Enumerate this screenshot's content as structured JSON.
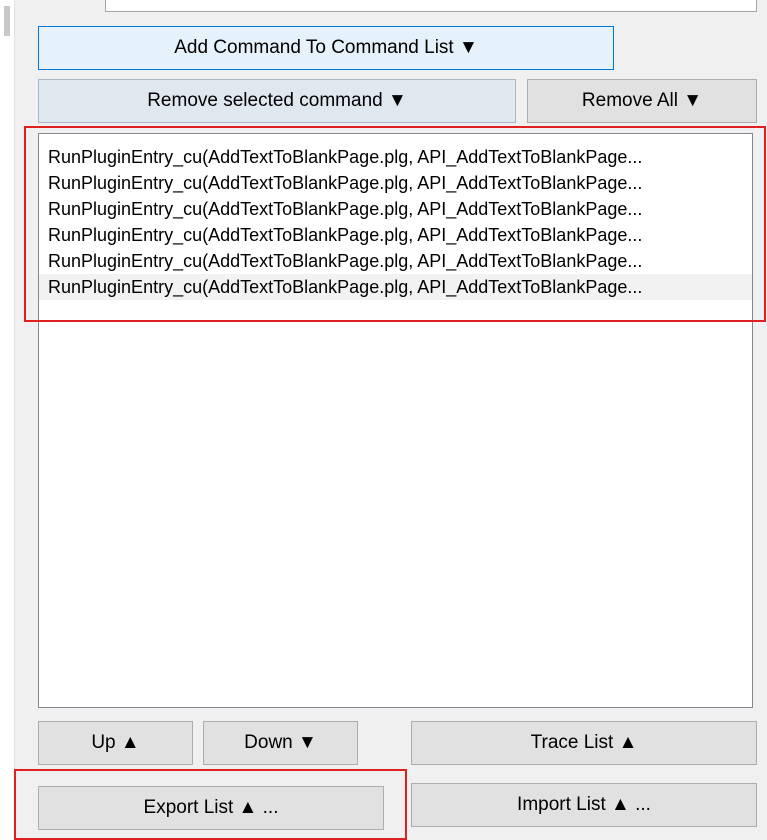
{
  "buttons": {
    "add_command": "Add Command To Command List ▼",
    "remove_selected": "Remove selected command ▼",
    "remove_all": "Remove All ▼",
    "up": "Up ▲",
    "down": "Down ▼",
    "trace_list": "Trace List ▲",
    "export_list": "Export List ▲ ...",
    "import_list": "Import List ▲ ..."
  },
  "command_list": {
    "items": [
      "RunPluginEntry_cu(AddTextToBlankPage.plg, API_AddTextToBlankPage...",
      "RunPluginEntry_cu(AddTextToBlankPage.plg, API_AddTextToBlankPage...",
      "RunPluginEntry_cu(AddTextToBlankPage.plg, API_AddTextToBlankPage...",
      "RunPluginEntry_cu(AddTextToBlankPage.plg, API_AddTextToBlankPage...",
      "RunPluginEntry_cu(AddTextToBlankPage.plg, API_AddTextToBlankPage...",
      "RunPluginEntry_cu(AddTextToBlankPage.plg, API_AddTextToBlankPage..."
    ],
    "selected_index": 5
  },
  "colors": {
    "highlight": "#e02020",
    "focus": "#0078d7"
  }
}
